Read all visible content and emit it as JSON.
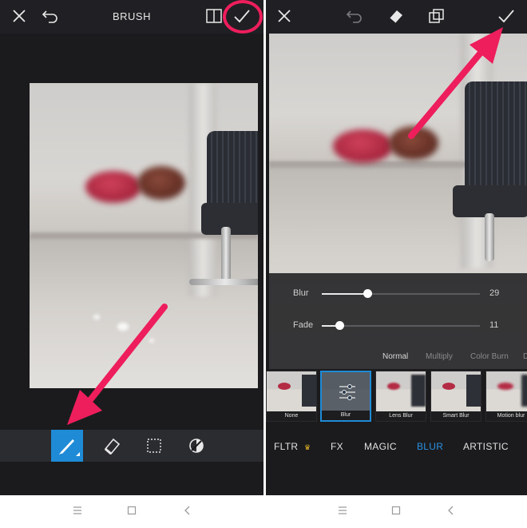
{
  "left_screen": {
    "title": "BRUSH",
    "toolbar_icons": [
      "close-icon",
      "undo-icon",
      "compare-icon",
      "checkmark-icon"
    ],
    "bottom_tools": [
      "brush-icon",
      "eraser-icon",
      "selection-icon",
      "invert-icon"
    ],
    "active_tool": "brush-icon"
  },
  "right_screen": {
    "toolbar_icons": [
      "close-icon",
      "undo-icon",
      "eraser-icon",
      "layers-icon",
      "checkmark-icon"
    ],
    "sliders": [
      {
        "label": "Blur",
        "value": 29,
        "fraction": 0.29
      },
      {
        "label": "Fade",
        "value": 11,
        "fraction": 0.11
      }
    ],
    "blend_modes": [
      "Normal",
      "Multiply",
      "Color Burn",
      "D"
    ],
    "selected_blend_mode": "Normal",
    "effects": [
      "None",
      "Blur",
      "Lens Blur",
      "Smart Blur",
      "Motion blur"
    ],
    "selected_effect": "Blur",
    "categories": [
      "FLTR",
      "FX",
      "MAGIC",
      "BLUR",
      "ARTISTIC"
    ],
    "active_category": "BLUR"
  },
  "annotation_color": "#ee1e5d",
  "accent_color": "#1f8bd6",
  "nav_icons": [
    "menu-icon",
    "home-icon",
    "back-icon"
  ]
}
